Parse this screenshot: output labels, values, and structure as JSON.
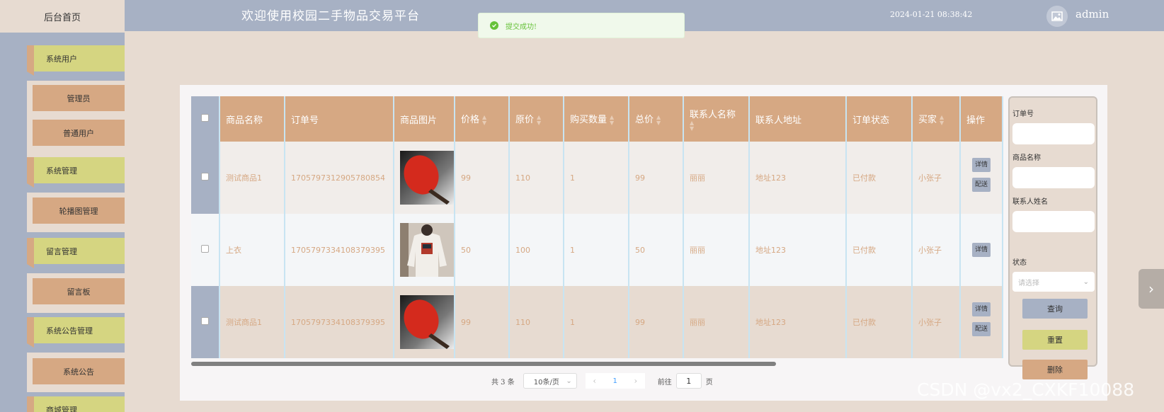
{
  "header": {
    "home_label": "后台首页",
    "title": "欢迎使用校园二手物品交易平台",
    "datetime": "2024-01-21 08:38:42",
    "username": "admin"
  },
  "toast": {
    "text": "提交成功!"
  },
  "sidebar": {
    "items": [
      {
        "label": "系统用户",
        "level": "top"
      },
      {
        "label": "管理员",
        "level": "sub"
      },
      {
        "label": "普通用户",
        "level": "sub"
      },
      {
        "label": "系统管理",
        "level": "top"
      },
      {
        "label": "轮播图管理",
        "level": "sub"
      },
      {
        "label": "留言管理",
        "level": "top"
      },
      {
        "label": "留言板",
        "level": "sub"
      },
      {
        "label": "系统公告管理",
        "level": "top"
      },
      {
        "label": "系统公告",
        "level": "sub"
      },
      {
        "label": "商城管理",
        "level": "top"
      }
    ]
  },
  "table": {
    "headers": [
      "商品名称",
      "订单号",
      "商品图片",
      "价格",
      "原价",
      "购买数量",
      "总价",
      "联系人名称",
      "联系人地址",
      "订单状态",
      "买家",
      "操作"
    ],
    "rows": [
      {
        "name": "测试商品1",
        "order_no": "1705797312905780854",
        "image": "paddle",
        "price": "99",
        "orig_price": "110",
        "qty": "1",
        "total": "99",
        "contact": "丽丽",
        "address": "地址123",
        "status": "已付款",
        "buyer": "小张子",
        "ops": [
          "详情",
          "配送"
        ]
      },
      {
        "name": "上衣",
        "order_no": "1705797334108379395",
        "image": "sweater",
        "price": "50",
        "orig_price": "100",
        "qty": "1",
        "total": "50",
        "contact": "丽丽",
        "address": "地址123",
        "status": "已付款",
        "buyer": "小张子",
        "ops": [
          "详情"
        ]
      },
      {
        "name": "测试商品1",
        "order_no": "1705797334108379395",
        "image": "paddle",
        "price": "99",
        "orig_price": "110",
        "qty": "1",
        "total": "99",
        "contact": "丽丽",
        "address": "地址123",
        "status": "已付款",
        "buyer": "小张子",
        "ops": [
          "详情",
          "配送"
        ]
      }
    ]
  },
  "pagination": {
    "total_text": "共 3 条",
    "page_size": "10条/页",
    "current_page": "1",
    "goto_prefix": "前往",
    "goto_value": "1",
    "goto_suffix": "页"
  },
  "search": {
    "order_no_label": "订单号",
    "product_name_label": "商品名称",
    "contact_name_label": "联系人姓名",
    "status_label": "状态",
    "status_placeholder": "请选择",
    "query_button": "查询",
    "reset_button": "重置",
    "delete_button": "删除"
  },
  "colors": {
    "sidebar_top": "#d5d581",
    "accent_tan": "#d6a883",
    "header_blue": "#a7b1c4",
    "content_bg": "#e7dbd1"
  },
  "watermark": "CSDN @vx2_CXKF10088"
}
